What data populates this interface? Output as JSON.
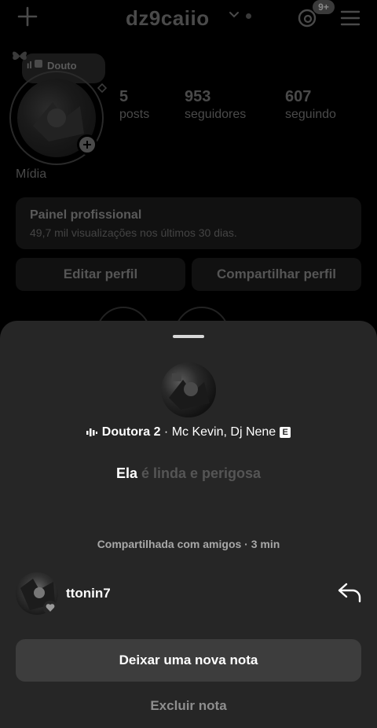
{
  "header": {
    "username": "dz9caiio",
    "notification_badge": "9+"
  },
  "profile": {
    "note_preview": "Douto",
    "stats": [
      {
        "value": "5",
        "label": "posts"
      },
      {
        "value": "953",
        "label": "seguidores"
      },
      {
        "value": "607",
        "label": "seguindo"
      }
    ],
    "category": "Mídia",
    "dashboard": {
      "title": "Painel profissional",
      "subtitle": "49,7 mil visualizações nos últimos 30 dias."
    },
    "buttons": {
      "edit": "Editar perfil",
      "share": "Compartilhar perfil"
    }
  },
  "sheet": {
    "song_title": "Doutora 2",
    "song_artist": "· Mc Kevin, Dj Nene",
    "explicit_label": "E",
    "lyric_active": "Ela",
    "lyric_rest": " é linda e perigosa",
    "shared_text": "Compartilhada com amigos · 3 min",
    "reply_user": "ttonin7",
    "new_note_button": "Deixar uma nova nota",
    "delete_note_button": "Excluir nota"
  },
  "colors": {
    "sheet_bg": "#262626",
    "primary_button_bg": "#3d3d3d",
    "muted_text": "#a8a8a8"
  },
  "icons": [
    "plus-icon",
    "chevron-down-icon",
    "threads-icon",
    "menu-icon",
    "butterfly-icon",
    "equalizer-icon",
    "reply-arrow-icon",
    "heart-icon"
  ]
}
